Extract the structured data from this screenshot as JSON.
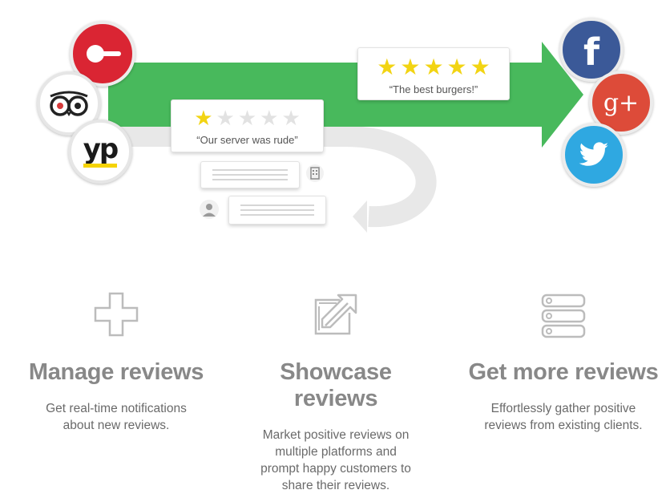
{
  "colors": {
    "arrow_green": "#48b95c",
    "return_gray": "#e8e8e8",
    "star_gold": "#f2d413",
    "star_empty": "#e2e2e2",
    "opentable_red": "#da2533",
    "facebook_blue": "#3b5998",
    "google_red": "#dd4b39",
    "twitter_blue": "#2fa8e1",
    "yellowpages_yellow": "#f5d304",
    "icon_gray": "#bcbcbc",
    "title_gray": "#888888"
  },
  "hero": {
    "source_logos": [
      "opentable-icon",
      "tripadvisor-icon",
      "yellowpages-icon"
    ],
    "yp_text": "yp",
    "target_logos": [
      "facebook-icon",
      "google-plus-icon",
      "twitter-icon"
    ],
    "google_text": "g+",
    "facebook_text": "f",
    "positive_review": {
      "rating": 5,
      "max": 5,
      "quote": "“The best burgers!”"
    },
    "negative_review": {
      "rating": 1,
      "max": 5,
      "quote": "“Our server was rude”"
    }
  },
  "features": [
    {
      "icon": "plus-icon",
      "title": "Manage reviews",
      "line1": "Get real-time notifications",
      "line2": "about new reviews."
    },
    {
      "icon": "share-icon",
      "title": "Showcase reviews",
      "line1": "Market positive reviews on",
      "line2": "multiple platforms and",
      "line3": "prompt happy customers to",
      "line4": "share their reviews."
    },
    {
      "icon": "server-stack-icon",
      "title": "Get more reviews",
      "line1": "Effortlessly gather positive",
      "line2": "reviews from existing clients."
    }
  ]
}
